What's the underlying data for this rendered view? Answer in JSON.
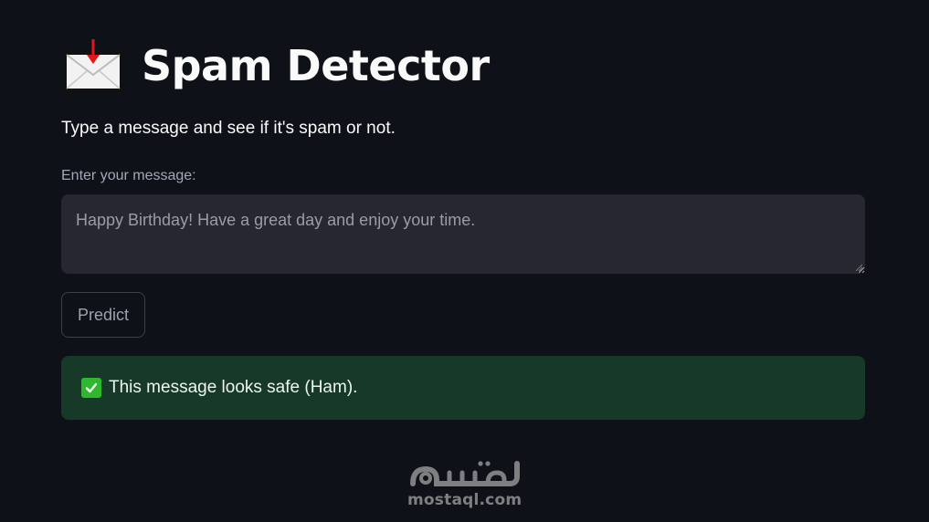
{
  "page": {
    "title": "Spam Detector",
    "title_icon": "incoming-envelope-icon",
    "subtitle": "Type a message and see if it's spam or not."
  },
  "form": {
    "label": "Enter your message:",
    "message_value": "Happy Birthday! Have a great day and enjoy your time.",
    "predict_label": "Predict"
  },
  "result": {
    "icon": "check-mark-icon",
    "text": "This message looks safe (Ham).",
    "status": "success"
  },
  "watermark": {
    "text": "mostaql.com",
    "logo_text": "مستقل"
  },
  "colors": {
    "background": "#0e1117",
    "input_bg": "#262730",
    "success_bg": "#173928",
    "check_green": "#2eb82e"
  }
}
